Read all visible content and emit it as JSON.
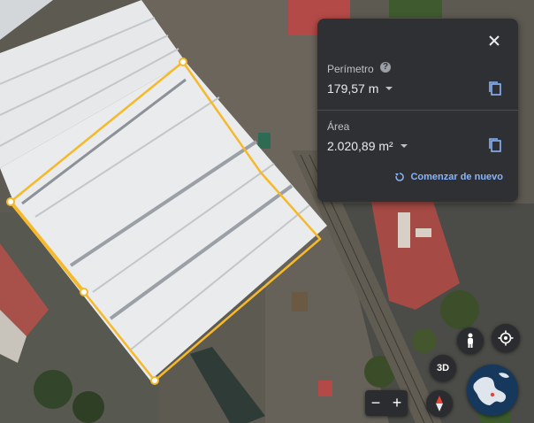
{
  "map": {
    "type": "satellite"
  },
  "measure_panel": {
    "perimeter": {
      "label": "Perímetro",
      "value": "179,57 m",
      "help_icon": "help-icon"
    },
    "area": {
      "label": "Área",
      "value": "2.020,89 m²"
    },
    "restart_label": "Comenzar de nuevo",
    "close_icon": "close-icon",
    "copy_icon": "copy-icon"
  },
  "controls": {
    "view_3d_label": "3D",
    "zoom_out_label": "−",
    "zoom_in_label": "+",
    "icons": [
      "pegman-icon",
      "my-location-icon",
      "compass-icon",
      "globe-icon"
    ]
  },
  "colors": {
    "panel_bg": "#2f3033",
    "accent": "#8ab4f8",
    "measure_line": "#f6b92b"
  }
}
